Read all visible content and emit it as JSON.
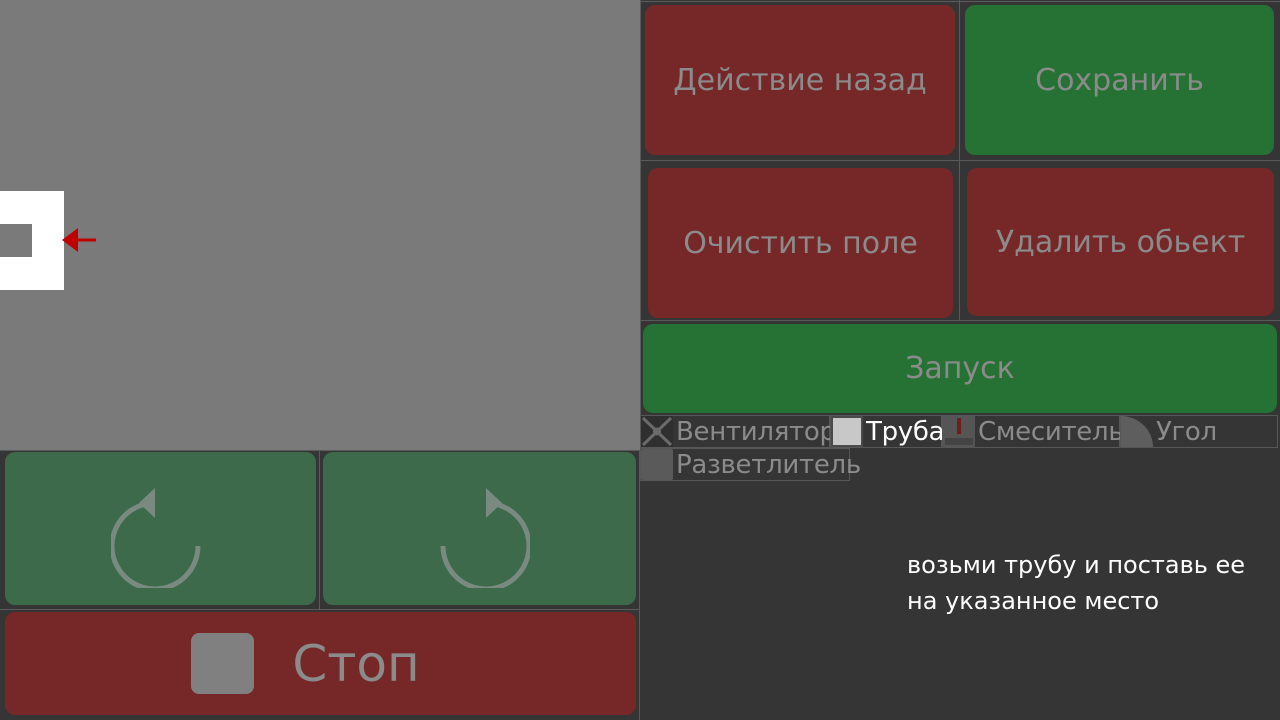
{
  "actions": {
    "undo": "Действие назад",
    "save": "Сохранить",
    "clear": "Очистить поле",
    "delete": "Удалить обьект",
    "run": "Запуск",
    "stop": "Стоп"
  },
  "tools": [
    {
      "label": "Вентилятор",
      "icon": "fan-icon",
      "active": false
    },
    {
      "label": "Труба",
      "icon": "pipe-icon",
      "active": true
    },
    {
      "label": "Смеситель",
      "icon": "mixer-icon",
      "active": false
    },
    {
      "label": "Угол",
      "icon": "corner-icon",
      "active": false
    },
    {
      "label": "Разветлитель",
      "icon": "splitter-icon",
      "active": false
    }
  ],
  "hint": {
    "line1": "возьми трубу и поставь ее",
    "line2": "на указанное место"
  },
  "colors": {
    "field": "#7a7a7a",
    "panel": "#353535",
    "red_button": "#762727",
    "green_button": "#267234",
    "rotate_button": "#3c6a4b",
    "arrow": "#c00000",
    "button_text": "#8b8b8b"
  }
}
